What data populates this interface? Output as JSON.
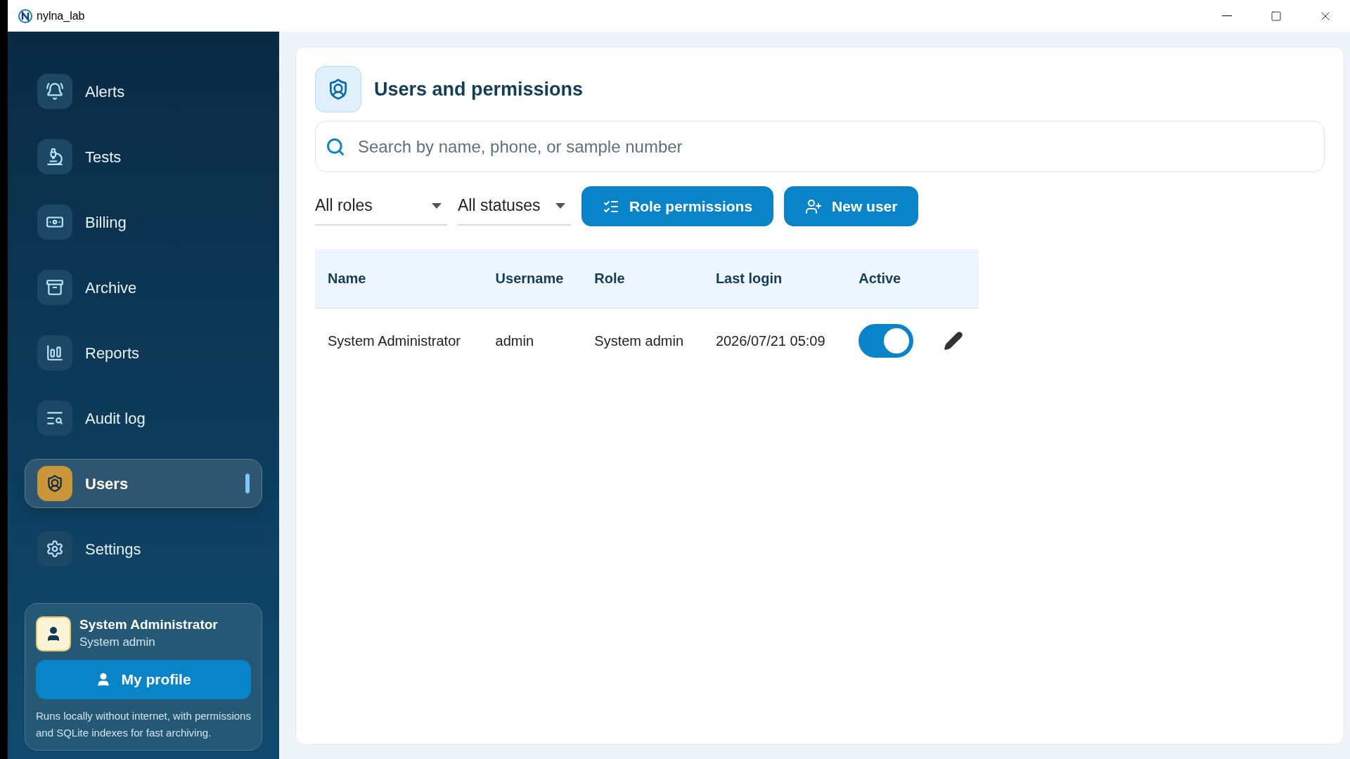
{
  "window": {
    "title": "nylna_lab"
  },
  "sidebar": {
    "items": [
      {
        "label": "Alerts",
        "selected": false
      },
      {
        "label": "Tests",
        "selected": false
      },
      {
        "label": "Billing",
        "selected": false
      },
      {
        "label": "Archive",
        "selected": false
      },
      {
        "label": "Reports",
        "selected": false
      },
      {
        "label": "Audit log",
        "selected": false
      },
      {
        "label": "Users",
        "selected": true
      },
      {
        "label": "Settings",
        "selected": false
      }
    ],
    "profile": {
      "name": "System Administrator",
      "role": "System admin",
      "button": "My profile",
      "note": "Runs locally without internet, with permissions and SQLite indexes for fast archiving."
    }
  },
  "main": {
    "title": "Users and permissions",
    "search": {
      "placeholder": "Search by name, phone, or sample number"
    },
    "filters": [
      {
        "value": "All roles"
      },
      {
        "value": "All statuses"
      }
    ],
    "buttons": [
      {
        "label": "Role permissions"
      },
      {
        "label": "New user"
      }
    ],
    "table": {
      "columns": [
        "Name",
        "Username",
        "Role",
        "Last login",
        "Active"
      ],
      "rows": [
        {
          "name": "System Administrator",
          "username": "admin",
          "role": "System admin",
          "last_login": "2026/07/21 05:09",
          "active": true
        }
      ]
    }
  }
}
